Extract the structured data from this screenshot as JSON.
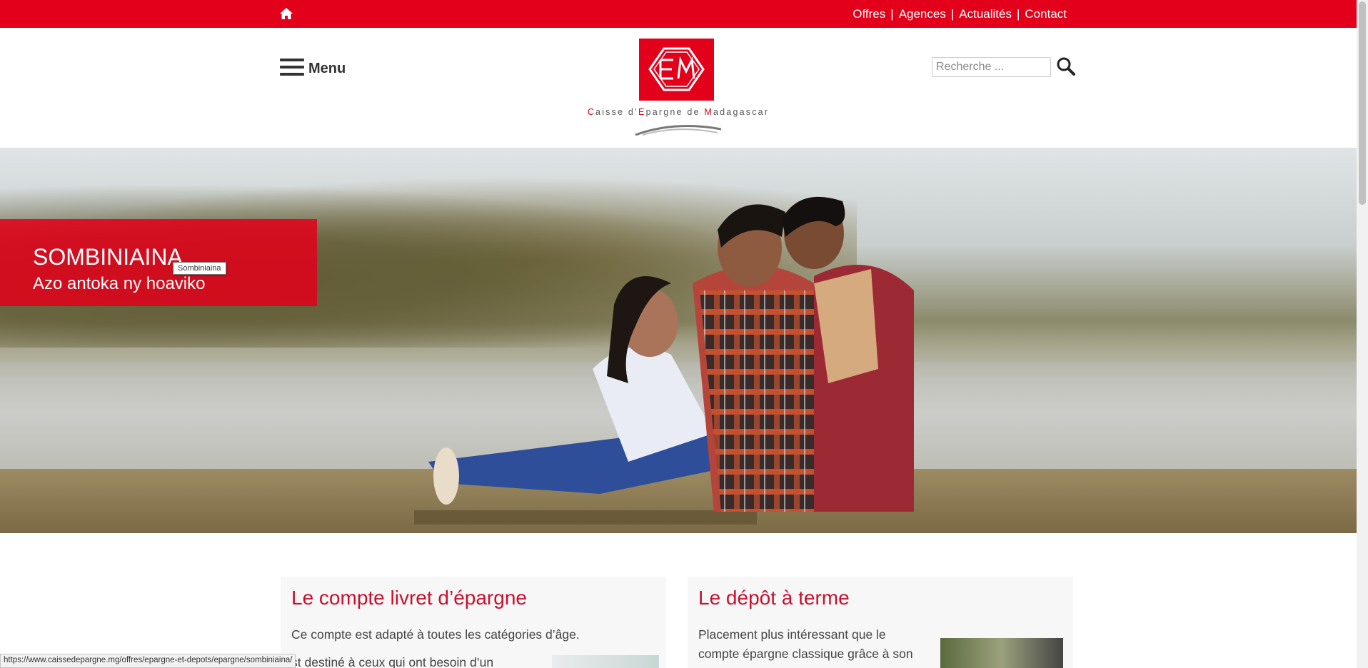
{
  "topbar": {
    "home_icon": "home-icon",
    "links": [
      "Offres",
      "Agences",
      "Actualités",
      "Contact"
    ],
    "color": "#e2001a"
  },
  "header": {
    "menu_label": "Menu",
    "logo_alt": "Caisse d'Epargne de Madagascar",
    "logo_text_parts": [
      "C",
      "aisse d’",
      "E",
      "pargne de ",
      "M",
      "adagascar"
    ],
    "search_placeholder": "Recherche ..."
  },
  "hero": {
    "title": "SOMBINIAINA",
    "subtitle": "Azo antoka ny hoaviko",
    "tooltip": "Sombiniaina",
    "slide_count": 5,
    "active_slide": 5
  },
  "cards": [
    {
      "title": "Le compte livret d’épargne",
      "text": "Ce compte est adapté à toutes les catégories d’âge.",
      "text2": "st destiné à ceux qui ont besoin d’un"
    },
    {
      "title": "Le dépôt à terme",
      "text_line1": "Placement plus intéressant que le",
      "text_line2": "compte épargne classique grâce à son"
    }
  ],
  "status_url": "https://www.caissedepargne.mg/offres/epargne-et-depots/epargne/sombiniaina/"
}
